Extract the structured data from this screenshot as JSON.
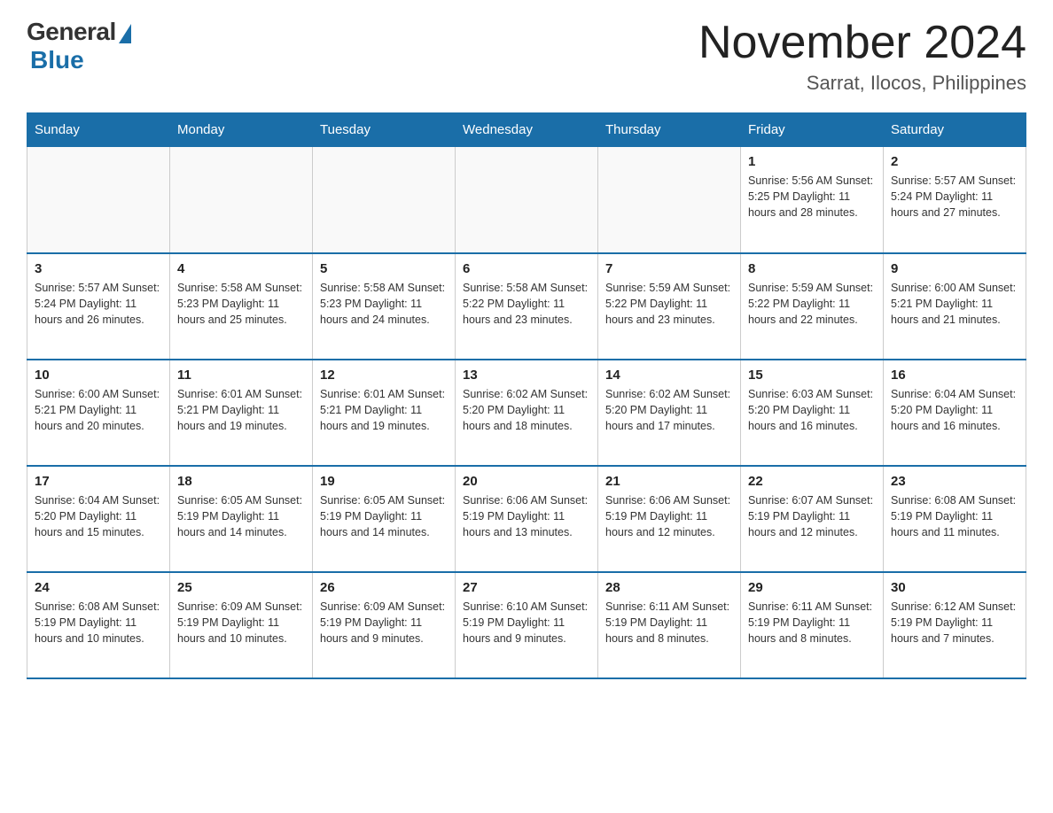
{
  "logo": {
    "general": "General",
    "blue": "Blue"
  },
  "header": {
    "month": "November 2024",
    "location": "Sarrat, Ilocos, Philippines"
  },
  "days_of_week": [
    "Sunday",
    "Monday",
    "Tuesday",
    "Wednesday",
    "Thursday",
    "Friday",
    "Saturday"
  ],
  "weeks": [
    [
      {
        "day": "",
        "info": ""
      },
      {
        "day": "",
        "info": ""
      },
      {
        "day": "",
        "info": ""
      },
      {
        "day": "",
        "info": ""
      },
      {
        "day": "",
        "info": ""
      },
      {
        "day": "1",
        "info": "Sunrise: 5:56 AM\nSunset: 5:25 PM\nDaylight: 11 hours and 28 minutes."
      },
      {
        "day": "2",
        "info": "Sunrise: 5:57 AM\nSunset: 5:24 PM\nDaylight: 11 hours and 27 minutes."
      }
    ],
    [
      {
        "day": "3",
        "info": "Sunrise: 5:57 AM\nSunset: 5:24 PM\nDaylight: 11 hours and 26 minutes."
      },
      {
        "day": "4",
        "info": "Sunrise: 5:58 AM\nSunset: 5:23 PM\nDaylight: 11 hours and 25 minutes."
      },
      {
        "day": "5",
        "info": "Sunrise: 5:58 AM\nSunset: 5:23 PM\nDaylight: 11 hours and 24 minutes."
      },
      {
        "day": "6",
        "info": "Sunrise: 5:58 AM\nSunset: 5:22 PM\nDaylight: 11 hours and 23 minutes."
      },
      {
        "day": "7",
        "info": "Sunrise: 5:59 AM\nSunset: 5:22 PM\nDaylight: 11 hours and 23 minutes."
      },
      {
        "day": "8",
        "info": "Sunrise: 5:59 AM\nSunset: 5:22 PM\nDaylight: 11 hours and 22 minutes."
      },
      {
        "day": "9",
        "info": "Sunrise: 6:00 AM\nSunset: 5:21 PM\nDaylight: 11 hours and 21 minutes."
      }
    ],
    [
      {
        "day": "10",
        "info": "Sunrise: 6:00 AM\nSunset: 5:21 PM\nDaylight: 11 hours and 20 minutes."
      },
      {
        "day": "11",
        "info": "Sunrise: 6:01 AM\nSunset: 5:21 PM\nDaylight: 11 hours and 19 minutes."
      },
      {
        "day": "12",
        "info": "Sunrise: 6:01 AM\nSunset: 5:21 PM\nDaylight: 11 hours and 19 minutes."
      },
      {
        "day": "13",
        "info": "Sunrise: 6:02 AM\nSunset: 5:20 PM\nDaylight: 11 hours and 18 minutes."
      },
      {
        "day": "14",
        "info": "Sunrise: 6:02 AM\nSunset: 5:20 PM\nDaylight: 11 hours and 17 minutes."
      },
      {
        "day": "15",
        "info": "Sunrise: 6:03 AM\nSunset: 5:20 PM\nDaylight: 11 hours and 16 minutes."
      },
      {
        "day": "16",
        "info": "Sunrise: 6:04 AM\nSunset: 5:20 PM\nDaylight: 11 hours and 16 minutes."
      }
    ],
    [
      {
        "day": "17",
        "info": "Sunrise: 6:04 AM\nSunset: 5:20 PM\nDaylight: 11 hours and 15 minutes."
      },
      {
        "day": "18",
        "info": "Sunrise: 6:05 AM\nSunset: 5:19 PM\nDaylight: 11 hours and 14 minutes."
      },
      {
        "day": "19",
        "info": "Sunrise: 6:05 AM\nSunset: 5:19 PM\nDaylight: 11 hours and 14 minutes."
      },
      {
        "day": "20",
        "info": "Sunrise: 6:06 AM\nSunset: 5:19 PM\nDaylight: 11 hours and 13 minutes."
      },
      {
        "day": "21",
        "info": "Sunrise: 6:06 AM\nSunset: 5:19 PM\nDaylight: 11 hours and 12 minutes."
      },
      {
        "day": "22",
        "info": "Sunrise: 6:07 AM\nSunset: 5:19 PM\nDaylight: 11 hours and 12 minutes."
      },
      {
        "day": "23",
        "info": "Sunrise: 6:08 AM\nSunset: 5:19 PM\nDaylight: 11 hours and 11 minutes."
      }
    ],
    [
      {
        "day": "24",
        "info": "Sunrise: 6:08 AM\nSunset: 5:19 PM\nDaylight: 11 hours and 10 minutes."
      },
      {
        "day": "25",
        "info": "Sunrise: 6:09 AM\nSunset: 5:19 PM\nDaylight: 11 hours and 10 minutes."
      },
      {
        "day": "26",
        "info": "Sunrise: 6:09 AM\nSunset: 5:19 PM\nDaylight: 11 hours and 9 minutes."
      },
      {
        "day": "27",
        "info": "Sunrise: 6:10 AM\nSunset: 5:19 PM\nDaylight: 11 hours and 9 minutes."
      },
      {
        "day": "28",
        "info": "Sunrise: 6:11 AM\nSunset: 5:19 PM\nDaylight: 11 hours and 8 minutes."
      },
      {
        "day": "29",
        "info": "Sunrise: 6:11 AM\nSunset: 5:19 PM\nDaylight: 11 hours and 8 minutes."
      },
      {
        "day": "30",
        "info": "Sunrise: 6:12 AM\nSunset: 5:19 PM\nDaylight: 11 hours and 7 minutes."
      }
    ]
  ]
}
